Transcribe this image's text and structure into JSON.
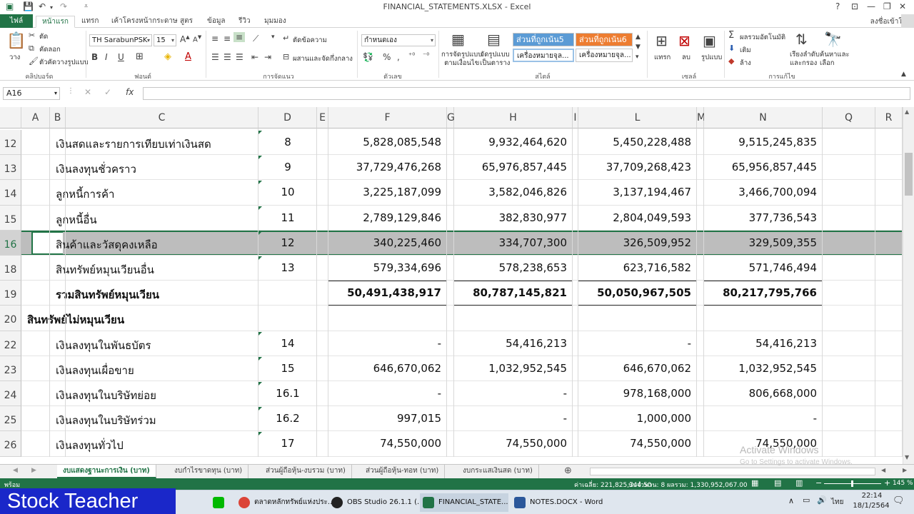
{
  "window": {
    "title": "FINANCIAL_STATEMENTS.XLSX - Excel",
    "help": "?",
    "signin": "ลงชื่อเข้าใช้"
  },
  "tabs": [
    "ไฟล์",
    "หน้าแรก",
    "แทรก",
    "เค้าโครงหน้ากระดาษ",
    "สูตร",
    "ข้อมูล",
    "รีวิว",
    "มุมมอง"
  ],
  "ribbon": {
    "paste": "วาง",
    "cut": "ตัด",
    "copy": "คัดลอก",
    "format_painter": "ตัวคัดวางรูปแบบ",
    "clipboard_label": "คลิปบอร์ด",
    "font_name": "TH SarabunPSK",
    "font_size": "15",
    "font_label": "ฟอนต์",
    "wrap_text": "ตัดข้อความ",
    "merge_center": "ผสานและจัดกึ่งกลาง",
    "alignment_label": "การจัดแนว",
    "number_format": "กำหนดเอง",
    "number_label": "ตัวเลข",
    "conditional_format": "การจัดรูปแบบ\nตามเงื่อนไข",
    "format_as_table": "จัดรูปแบบ\nเป็นตาราง",
    "style1": "ส่วนที่ถูกเน้น5",
    "style2": "ส่วนที่ถูกเน้น6",
    "style3": "เครื่องหมายจุล...",
    "style4": "เครื่องหมายจุล...",
    "styles_label": "สไตล์",
    "insert": "แทรก",
    "delete": "ลบ",
    "format": "รูปแบบ",
    "cells_label": "เซลล์",
    "autosum": "ผลรวมอัตโนมัติ",
    "fill": "เติม",
    "clear": "ล้าง",
    "sort_filter": "เรียงลำดับ\nและกรอง",
    "find_select": "ค้นหาและ\nเลือก",
    "editing_label": "การแก้ไข"
  },
  "formula_bar": {
    "name_box": "A16",
    "formula": ""
  },
  "columns": [
    "A",
    "B",
    "C",
    "D",
    "E",
    "F",
    "G",
    "H",
    "I",
    "L",
    "M",
    "N",
    "Q",
    "R"
  ],
  "rows": [
    {
      "num": "12",
      "label": "เงินสดและรายการเทียบเท่าเงินสด",
      "note": "8",
      "f": "5,828,085,548",
      "h": "9,932,464,620",
      "l": "5,450,228,488",
      "n": "9,515,245,835"
    },
    {
      "num": "13",
      "label": "เงินลงทุนชั่วคราว",
      "note": "9",
      "f": "37,729,476,268",
      "h": "65,976,857,445",
      "l": "37,709,268,423",
      "n": "65,956,857,445"
    },
    {
      "num": "14",
      "label": "ลูกหนี้การค้า",
      "note": "10",
      "f": "3,225,187,099",
      "h": "3,582,046,826",
      "l": "3,137,194,467",
      "n": "3,466,700,094"
    },
    {
      "num": "15",
      "label": "ลูกหนี้อื่น",
      "note": "11",
      "f": "2,789,129,846",
      "h": "382,830,977",
      "l": "2,804,049,593",
      "n": "377,736,543"
    },
    {
      "num": "16",
      "label": "สินค้าและวัสดุคงเหลือ",
      "note": "12",
      "f": "340,225,460",
      "h": "334,707,300",
      "l": "326,509,952",
      "n": "329,509,355"
    },
    {
      "num": "18",
      "label": "สินทรัพย์หมุนเวียนอื่น",
      "note": "13",
      "f": "579,334,696",
      "h": "578,238,653",
      "l": "623,716,582",
      "n": "571,746,494"
    },
    {
      "num": "19",
      "label": "รวมสินทรัพย์หมุนเวียน",
      "note": "",
      "f": "50,491,438,917",
      "h": "80,787,145,821",
      "l": "50,050,967,505",
      "n": "80,217,795,766"
    },
    {
      "num": "20",
      "label": "สินทรัพย์ไม่หมุนเวียน",
      "note": "",
      "f": "",
      "h": "",
      "l": "",
      "n": ""
    },
    {
      "num": "22",
      "label": "เงินลงทุนในพันธบัตร",
      "note": "14",
      "f": "-",
      "h": "54,416,213",
      "l": "-",
      "n": "54,416,213"
    },
    {
      "num": "23",
      "label": "เงินลงทุนเผื่อขาย",
      "note": "15",
      "f": "646,670,062",
      "h": "1,032,952,545",
      "l": "646,670,062",
      "n": "1,032,952,545"
    },
    {
      "num": "24",
      "label": "เงินลงทุนในบริษัทย่อย",
      "note": "16.1",
      "f": "-",
      "h": "-",
      "l": "978,168,000",
      "n": "806,668,000"
    },
    {
      "num": "25",
      "label": "เงินลงทุนในบริษัทร่วม",
      "note": "16.2",
      "f": "997,015",
      "h": "-",
      "l": "1,000,000",
      "n": "-"
    },
    {
      "num": "26",
      "label": "เงินลงทุนทั่วไป",
      "note": "17",
      "f": "74,550,000",
      "h": "74,550,000",
      "l": "74,550,000",
      "n": "74,550,000"
    }
  ],
  "sheets": [
    "งบแสดงฐานะการเงิน (บาท)",
    "งบกำไรขาดทุน (บาท)",
    "ส่วนผู้ถือหุ้น-งบรวม (บาท)",
    "ส่วนผู้ถือหุ้น-ทอท (บาท)",
    "งบกระแสเงินสด (บาท)"
  ],
  "status": {
    "ready": "พร้อม",
    "average": "ค่าเฉลี่ย: 221,825,344.50",
    "count": "นับจำนวน: 8",
    "sum": "ผลรวม: 1,330,952,067.00",
    "zoom": "145 %"
  },
  "watermark": {
    "line1": "Activate Windows",
    "line2": "Go to Settings to activate Windows."
  },
  "taskbar": {
    "brand": "Stock Teacher",
    "chrome": "ตลาดหลักทรัพย์แห่งประ...",
    "obs": "OBS Studio 26.1.1 (...",
    "excel": "FINANCIAL_STATE...",
    "word": "NOTES.DOCX - Word",
    "lang": "ไทย",
    "time": "22:14",
    "date": "18/1/2564"
  },
  "colors": {
    "excel_green": "#217346",
    "selection_gray": "#bdbdbd",
    "style1_bg": "#5b9bd5",
    "style2_bg": "#ed7d31",
    "brand_blue": "#1a27c9"
  }
}
